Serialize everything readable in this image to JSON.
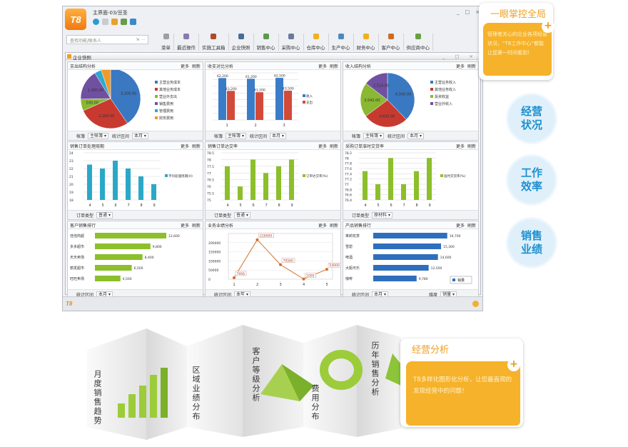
{
  "window": {
    "logo": "T8",
    "title": "主界面-03/豆圣",
    "controls": [
      "_",
      "□",
      "×"
    ],
    "search_placeholder": "查找功能/联系人",
    "toolbar": [
      "菜单",
      "最近操作",
      "实施工具箱",
      "企业快照",
      "销售中心",
      "采购中心",
      "仓库中心",
      "生产中心",
      "财务中心",
      "客户中心",
      "供应商中心"
    ],
    "toolbar_icon_colors": [
      "#9aa0a8",
      "#8a7ab0",
      "#b04a2a",
      "#4a6a9a",
      "#5a9a4a",
      "#6a7a9a",
      "#f0b020",
      "#4a8ac0",
      "#f0b020",
      "#d06a20",
      "#6aa040"
    ],
    "inner_title": "企业快照",
    "inner_controls": "_ □ ×",
    "status_logo": "T8"
  },
  "panels": [
    {
      "title": "支出结构分析",
      "more": "更多",
      "refresh": "刷新",
      "footer": [
        [
          "帐簿",
          "主帐簿"
        ],
        [
          "统计区间",
          "本月"
        ]
      ]
    },
    {
      "title": "收支对比分析",
      "more": "更多",
      "refresh": "刷新",
      "footer": [
        [
          "帐簿",
          "主帐簿"
        ],
        [
          "统计区间",
          "本月"
        ]
      ]
    },
    {
      "title": "收入结构分析",
      "more": "更多",
      "refresh": "刷新",
      "footer": [
        [
          "帐簿",
          "主帐簿"
        ],
        [
          "统计区间",
          "本月"
        ]
      ]
    },
    {
      "title": "销售订单处理周期",
      "more": "更多",
      "refresh": "刷新",
      "footer": [
        [
          "订单类型",
          "普通"
        ]
      ]
    },
    {
      "title": "销售订单达交率",
      "more": "更多",
      "refresh": "刷新",
      "footer": [
        [
          "订单类型",
          "普通"
        ]
      ]
    },
    {
      "title": "采购订单准时交货率",
      "more": "更多",
      "refresh": "刷新",
      "footer": [
        [
          "订单类型",
          "原材料"
        ]
      ]
    },
    {
      "title": "客户销售排行",
      "more": "更多",
      "refresh": "刷新",
      "footer": [
        [
          "统计区间",
          "本月"
        ]
      ]
    },
    {
      "title": "业务业绩分析",
      "more": "更多",
      "refresh": "刷新",
      "footer": [
        [
          "统计区间",
          "本年"
        ]
      ]
    },
    {
      "title": "产品销售排行",
      "more": "更多",
      "refresh": "刷新",
      "footer": [
        [
          "统计区间",
          "本月"
        ],
        [
          "维度",
          "销量"
        ]
      ]
    }
  ],
  "chart_data": [
    {
      "type": "pie",
      "categories": [
        "主营业务成本",
        "其他业务成本",
        "营业外支出",
        "销售费用",
        "管理费用",
        "财务费用"
      ],
      "values": [
        3200,
        2200,
        500,
        1300,
        300,
        400
      ],
      "labels": [
        "3,200.00",
        "2,200.00",
        "500.00",
        "1,300.00",
        "300.00",
        "400.00"
      ],
      "colors": [
        "#3a78c2",
        "#c83a30",
        "#8ab832",
        "#7050a0",
        "#30a8d0",
        "#f09a28"
      ],
      "legend": "right"
    },
    {
      "type": "bar",
      "categories": [
        "1",
        "2",
        "3"
      ],
      "series": [
        {
          "name": "收入",
          "values": [
            62200,
            61200,
            62500
          ],
          "color": "#3a7cc8"
        },
        {
          "name": "支出",
          "values": [
            43200,
            41200,
            43500
          ],
          "color": "#d24a3a"
        }
      ],
      "ylim": [
        0,
        70000
      ],
      "show_yticks": false,
      "data_labels": true,
      "legend": "right"
    },
    {
      "type": "pie",
      "categories": [
        "主营业务收入",
        "其他业务收入",
        "投资收益",
        "营业外收入"
      ],
      "values": [
        6500,
        4650,
        3542,
        2514
      ],
      "labels": [
        "6,500.00",
        "4,650.00",
        "3,542.00",
        "2,514.00"
      ],
      "colors": [
        "#3a78c2",
        "#c83a30",
        "#8ab832",
        "#7050a0"
      ],
      "legend": "right"
    },
    {
      "type": "bar",
      "categories": [
        "4",
        "5",
        "6",
        "7",
        "8",
        "9"
      ],
      "series": [
        {
          "name": "平均处理周期(H)",
          "values": [
            22.5,
            22,
            23,
            22,
            21,
            20
          ],
          "color": "#2aa8c8"
        }
      ],
      "ylim": [
        18,
        24
      ],
      "yticks": [
        18,
        19,
        20,
        21,
        22,
        23,
        24
      ],
      "legend": "right"
    },
    {
      "type": "bar",
      "categories": [
        "4",
        "5",
        "6",
        "7",
        "8",
        "9"
      ],
      "series": [
        {
          "name": "订单达交率(%)",
          "values": [
            77.5,
            76,
            78,
            77,
            77.5,
            78
          ],
          "color": "#8cbf2a"
        }
      ],
      "ylim": [
        75,
        78.5
      ],
      "yticks": [
        75,
        75.5,
        76,
        76.5,
        77,
        77.5,
        78,
        78.5
      ],
      "legend": "right"
    },
    {
      "type": "bar",
      "categories": [
        "4",
        "5",
        "6",
        "7",
        "8",
        "9"
      ],
      "series": [
        {
          "name": "准时交货率(%)",
          "values": [
            77.5,
            77,
            78,
            77,
            77.5,
            78
          ],
          "color": "#8cbf2a"
        }
      ],
      "ylim": [
        76.4,
        78.2
      ],
      "yticks": [
        76.4,
        76.6,
        76.8,
        77,
        77.2,
        77.4,
        77.6,
        77.8,
        78,
        78.2
      ],
      "legend": "right"
    },
    {
      "type": "hbar",
      "categories": [
        "佳佳商超",
        "多多超市",
        "天天卖场",
        "丽发超市",
        "旺旺卖场"
      ],
      "values": [
        12600,
        9800,
        8400,
        6500,
        4500
      ],
      "labels": [
        "12,600",
        "9,800",
        "8,400",
        "6,500",
        "4,500"
      ],
      "xlim": [
        0,
        16000
      ],
      "color": "#8cbf2a"
    },
    {
      "type": "line",
      "x": [
        "1",
        "2",
        "3",
        "4",
        "5"
      ],
      "values": [
        7956,
        216000,
        79560,
        1000,
        54000
      ],
      "labels": [
        "7956",
        "216000",
        "79560",
        "1000",
        "54000"
      ],
      "ylim": [
        0,
        250000
      ],
      "yticks": [
        0,
        50000,
        100000,
        150000,
        200000
      ],
      "color": "#d0702a"
    },
    {
      "type": "hbar",
      "categories": [
        "茉莉花茶",
        "雪碧",
        "啤酒",
        "大瓶可乐",
        "咖啡"
      ],
      "values": [
        16700,
        15300,
        14600,
        12500,
        9780
      ],
      "labels": [
        "16,700",
        "15,300",
        "14,600",
        "12,500",
        "9,780"
      ],
      "xlim": [
        0,
        19000
      ],
      "color": "#2e6fbd",
      "series_name": "销量",
      "legend": "bottom-right"
    }
  ],
  "callout_top": {
    "title": "一眼掌控全局",
    "body": "管理者关心的企业各项经营状况，“T8工作中心”都能让您第一时间看到！",
    "plus": "+"
  },
  "badges": [
    "经营\n状况",
    "工作\n效率",
    "销售\n业绩"
  ],
  "brochure": {
    "labels": [
      "月度销售趋势",
      "区域业绩分布",
      "客户等级分析",
      "费用分布",
      "历年销售分析"
    ]
  },
  "callout_bottom": {
    "title": "经营分析",
    "body": "T8多样化图形化分析，让您最直观的发现经营中的问题！",
    "plus": "+"
  },
  "colors": {
    "accent": "#f5b22a",
    "badge_text": "#1e90d0",
    "green": "#8cc43a"
  }
}
